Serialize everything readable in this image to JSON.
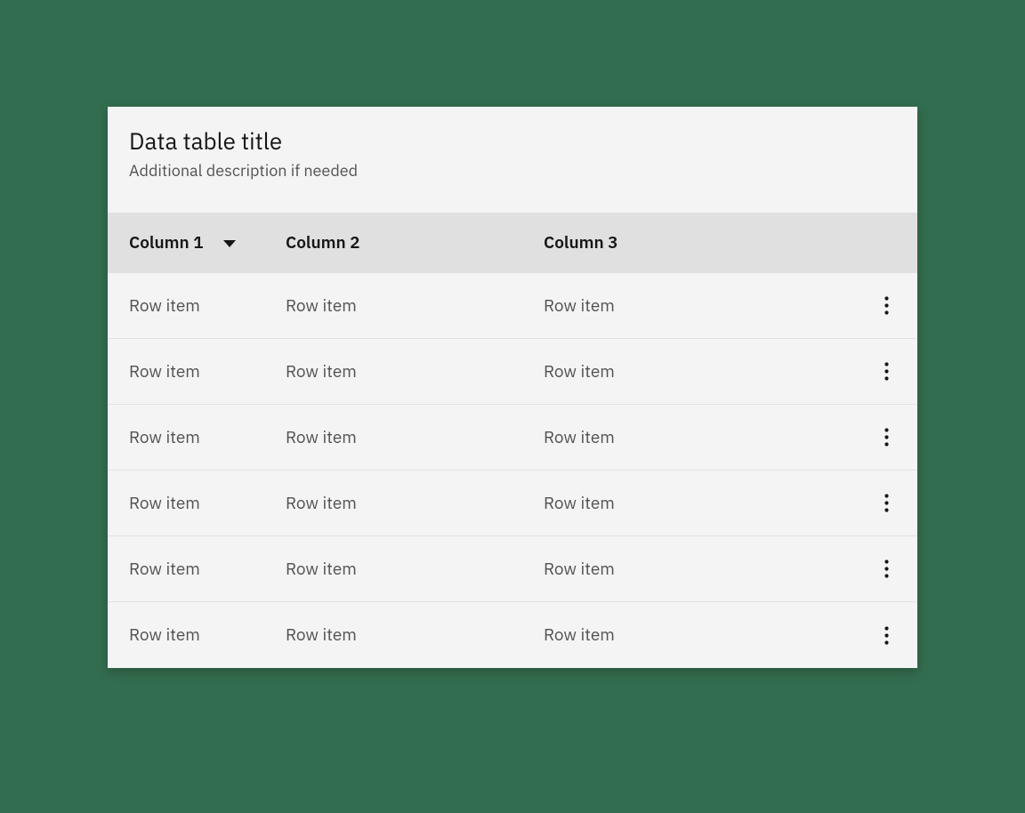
{
  "header": {
    "title": "Data table title",
    "description": "Additional description if needed"
  },
  "columns": [
    {
      "label": "Column 1",
      "sortable": true
    },
    {
      "label": "Column 2",
      "sortable": false
    },
    {
      "label": "Column 3",
      "sortable": false
    }
  ],
  "rows": [
    {
      "cells": [
        "Row item",
        "Row item",
        "Row item"
      ]
    },
    {
      "cells": [
        "Row item",
        "Row item",
        "Row item"
      ]
    },
    {
      "cells": [
        "Row item",
        "Row item",
        "Row item"
      ]
    },
    {
      "cells": [
        "Row item",
        "Row item",
        "Row item"
      ]
    },
    {
      "cells": [
        "Row item",
        "Row item",
        "Row item"
      ]
    },
    {
      "cells": [
        "Row item",
        "Row item",
        "Row item"
      ]
    }
  ]
}
